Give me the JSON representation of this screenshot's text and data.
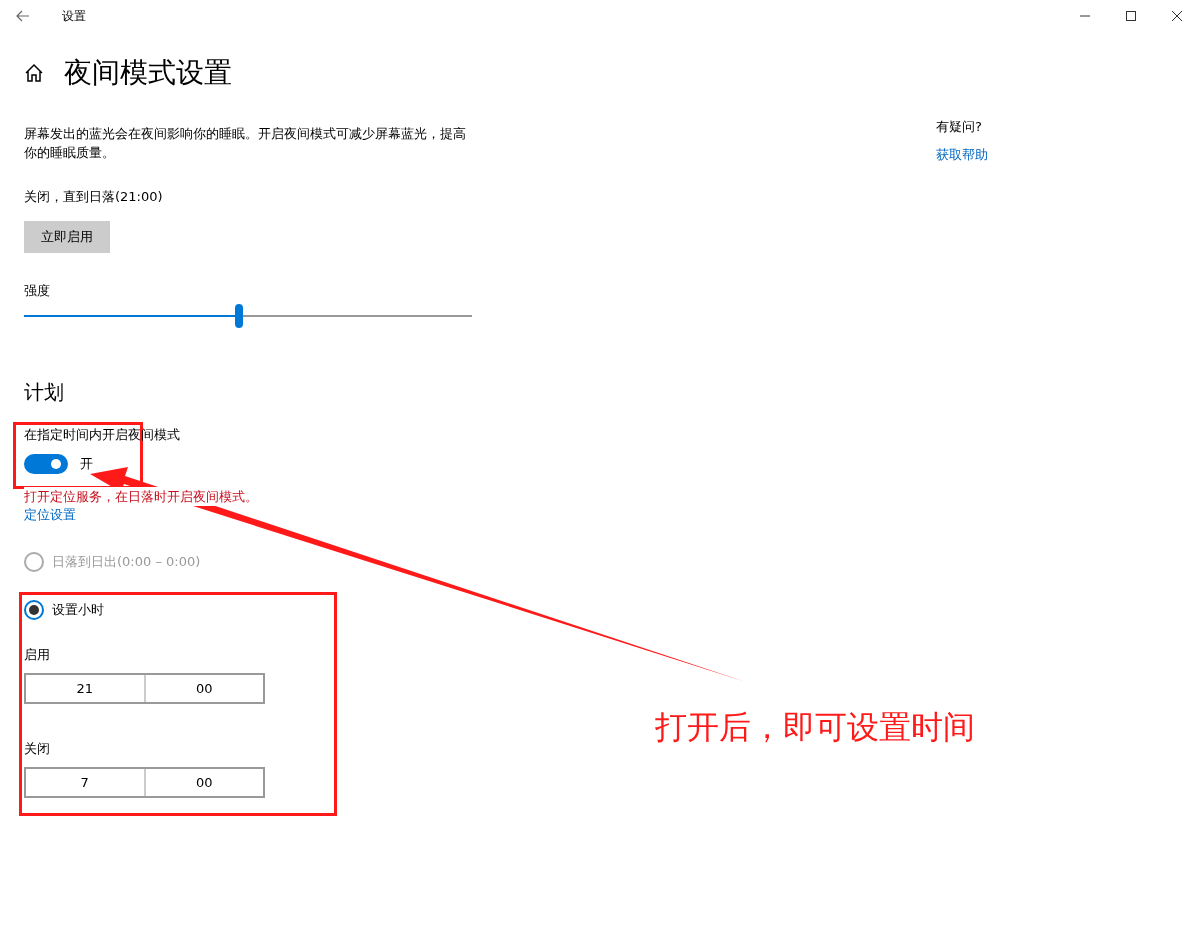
{
  "window": {
    "title": "设置"
  },
  "page": {
    "title": "夜间模式设置"
  },
  "description": "屏幕发出的蓝光会在夜间影响你的睡眠。开启夜间模式可减少屏幕蓝光，提高你的睡眠质量。",
  "status": "关闭，直到日落(21:00)",
  "enable_button": "立即启用",
  "intensity": {
    "label": "强度",
    "level": 0.48
  },
  "schedule": {
    "heading": "计划",
    "toggle_label": "在指定时间内开启夜间模式",
    "toggle": {
      "on": true,
      "label": "开"
    },
    "warning": "打开定位服务，在日落时开启夜间模式。",
    "location_link": "定位设置",
    "options": [
      {
        "label": "日落到日出(0:00 – 0:00)",
        "selected": false,
        "disabled": true
      },
      {
        "label": "设置小时",
        "selected": true,
        "disabled": false
      }
    ],
    "times": [
      {
        "label": "启用",
        "hour": "21",
        "minute": "00"
      },
      {
        "label": "关闭",
        "hour": "7",
        "minute": "00"
      }
    ]
  },
  "help": {
    "question": "有疑问?",
    "link": "获取帮助"
  },
  "annotation": {
    "text": "打开后，即可设置时间"
  }
}
